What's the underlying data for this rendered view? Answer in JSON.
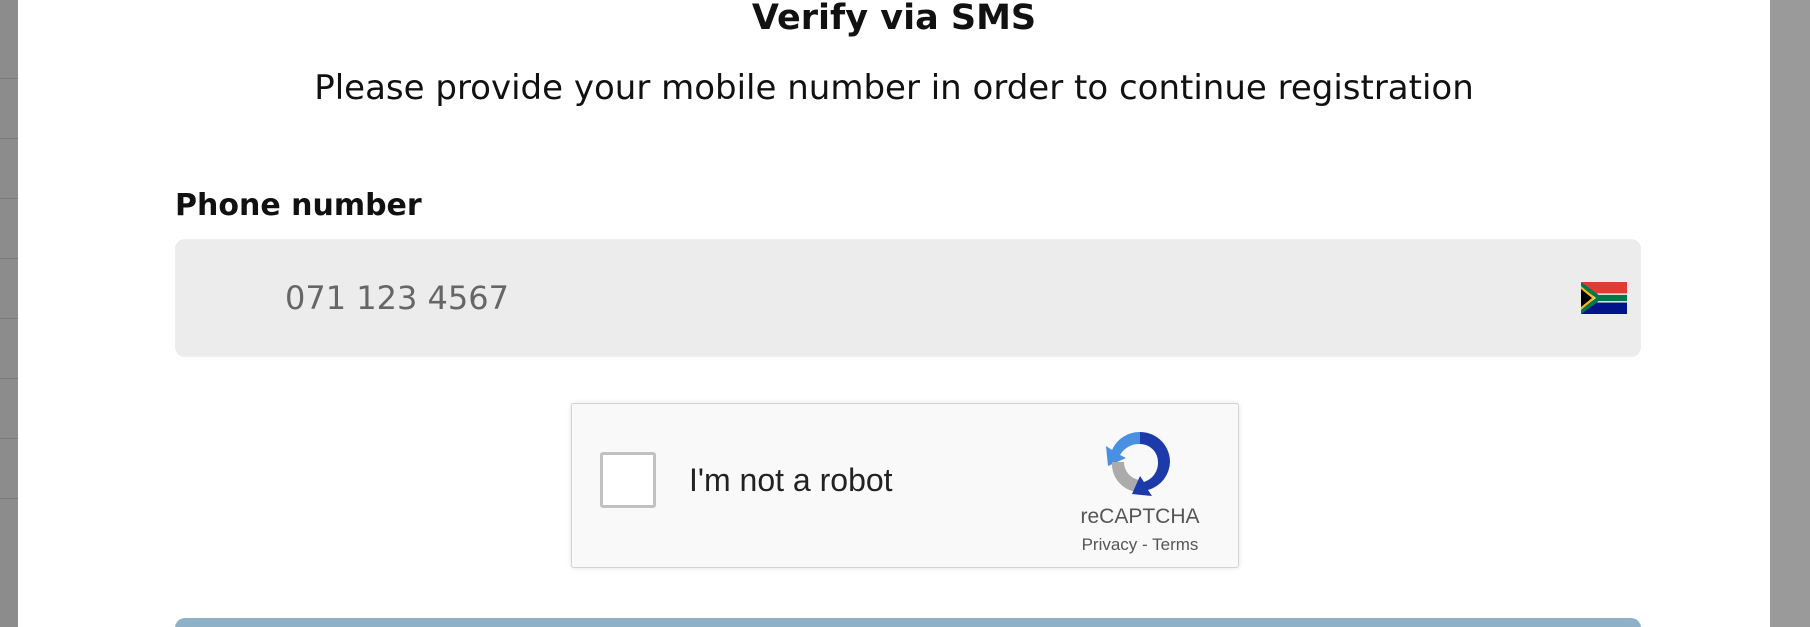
{
  "modal": {
    "title": "Verify via SMS",
    "subtitle": "Please provide your mobile number in order to continue registration"
  },
  "phone": {
    "label": "Phone number",
    "placeholder": "071 123 4567",
    "value": "",
    "country_flag_icon": "south-africa-flag-icon"
  },
  "captcha": {
    "label": "I'm not a robot",
    "brand": "reCAPTCHA",
    "privacy": "Privacy",
    "separator": "-",
    "terms": "Terms",
    "checked": false,
    "logo_icon": "recaptcha-logo-icon"
  },
  "colors": {
    "overlay": "#9a9a9a",
    "field_background": "#ececec",
    "button": "#8eb1c7"
  }
}
